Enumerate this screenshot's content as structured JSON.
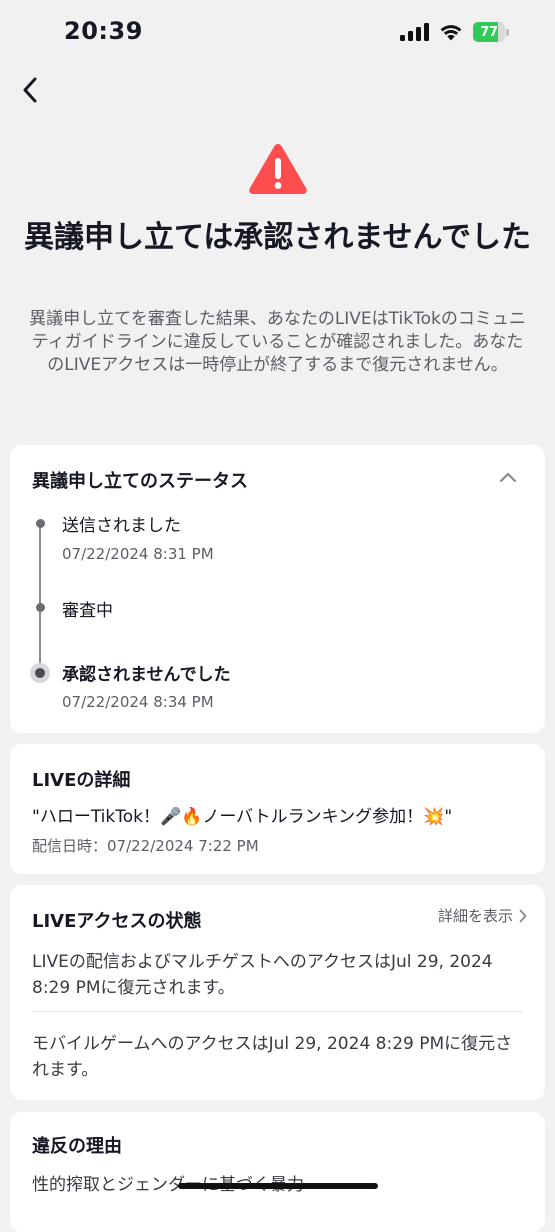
{
  "status_bar": {
    "time": "20:39",
    "battery_percent": 77,
    "battery_label": "77",
    "battery_color": "#34c759"
  },
  "icons": {
    "back": "chevron-left-icon",
    "warning": "warning-triangle-icon",
    "collapse": "chevron-up-icon",
    "details": "chevron-right-icon"
  },
  "header": {
    "title": "異議申し立ては承認されませんでした",
    "description": "異議申し立てを審査した結果、あなたのLIVEはTikTokのコミュニティガイドラインに違反していることが確認されました。あなたのLIVEアクセスは一時停止が終了するまで復元されません。",
    "warning_color": "#fe4d4f"
  },
  "appeal_status": {
    "title": "異議申し立てのステータス",
    "steps": [
      {
        "label": "送信されました",
        "time": "07/22/2024 8:31 PM"
      },
      {
        "label": "審査中",
        "time": ""
      },
      {
        "label": "承認されませんでした",
        "time": "07/22/2024 8:34 PM"
      }
    ]
  },
  "live_details": {
    "title": "LIVEの詳細",
    "live_title": "\"ハローTikTok！🎤🔥ノーバトルランキング参加！💥\"",
    "stream_date": "配信日時：07/22/2024 7:22 PM"
  },
  "live_access": {
    "title": "LIVEアクセスの状態",
    "details_link": "詳細を表示",
    "items": [
      "LIVEの配信およびマルチゲストへのアクセスはJul 29, 2024 8:29 PMに復元されます。",
      "モバイルゲームへのアクセスはJul 29, 2024 8:29 PMに復元されます。"
    ]
  },
  "violation_reason": {
    "title": "違反の理由",
    "text": "性的搾取とジェンダーに基づく暴力"
  }
}
